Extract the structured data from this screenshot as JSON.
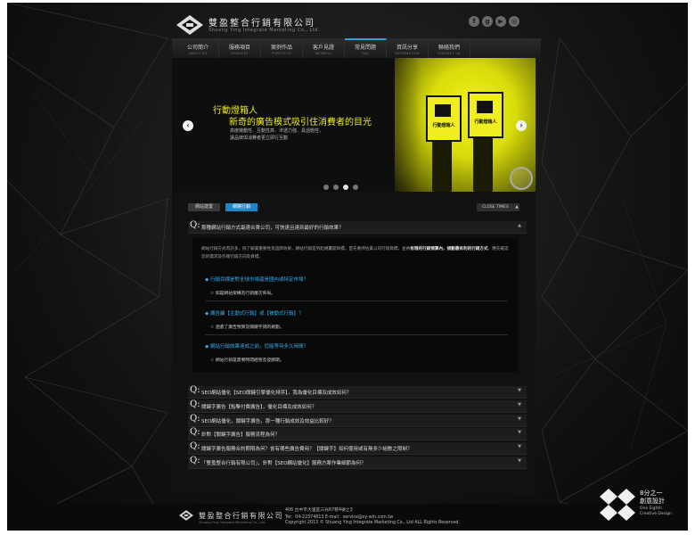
{
  "header": {
    "company_cn": "雙盈整合行銷有限公司",
    "company_en": "Shuang Ying Integrate Marketing Co., Ltd.",
    "social": [
      "f",
      "g",
      "▶",
      "◎"
    ]
  },
  "nav": [
    {
      "cn": "公司簡介",
      "en": "ABOUT US"
    },
    {
      "cn": "服務項目",
      "en": "SERVICES"
    },
    {
      "cn": "案例作品",
      "en": "PORTFOLIO"
    },
    {
      "cn": "客戶見證",
      "en": "WITNESS"
    },
    {
      "cn": "常見問題",
      "en": "FAQ",
      "active": true
    },
    {
      "cn": "資訊分享",
      "en": "INFORMATION"
    },
    {
      "cn": "聯絡我們",
      "en": "CONTACT US"
    }
  ],
  "banner": {
    "title1": "行動燈箱人",
    "title2": "新奇的廣告模式吸引住消費者的目光",
    "lines": [
      "高度機動性．互動性高．滲透力強．具話題性，",
      "讓品牌與消費者更立即行互動"
    ],
    "board_text": "行動燈箱人",
    "left_arrow": "‹",
    "right_arrow": "›",
    "dots": [
      false,
      false,
      true,
      false
    ]
  },
  "tabs": {
    "items": [
      "網站建置",
      "網路行銷"
    ],
    "active_index": 1,
    "close_label": "CLOSE TIMES",
    "close_icon": "▲"
  },
  "faq_open": {
    "q": "Q:",
    "question": "那種網站行銷方式最適合貴公司，可快速且達到最好的行銷效果？",
    "chevron": "▲",
    "intro_part1": "網站行銷方式有許多，除了解貴重要性及品牌效果，網站行銷是另起規畫開目標，首先要評估貴公司行銷目標，並依",
    "intro_bold": "有限的行銷預算內，規劃最有利的行銷方式",
    "intro_part2": "，應先確認您的需求及作哪行銷方向及目標。",
    "sub": [
      {
        "q": "◆ 行銷目標是對全球市場還是國內或特定市場？",
        "a": "☆ 如是網站架構及行銷層次佈局。"
      },
      {
        "q": "◆ 廣告屬【主動式行銷】或【被動式行銷】？",
        "a": "☆ 涵蓋了廣告預算及關鍵字詞的規劃。"
      },
      {
        "q": "◆ 網站行銷效果達成之前，您能等待多久時間？",
        "a": "☆ 網站行銷是需要時間經營及發酵期。"
      }
    ]
  },
  "faq_closed": [
    {
      "q": "Q:",
      "text": "SEO網站優化【SEO關鍵引擎優化排序】，我為優化目標及成效如何？",
      "chevron": "▼"
    },
    {
      "q": "Q:",
      "text": "關鍵字廣告【點擊付費廣告】，優化目標及成效如何？",
      "chevron": "▼"
    },
    {
      "q": "Q:",
      "text": "SEO網站優化，關鍵字廣告，那一種行銷成效及效益比較好？",
      "chevron": "▼"
    },
    {
      "q": "Q:",
      "text": "針對【關鍵字廣告】服務流程為何？",
      "chevron": "▼"
    },
    {
      "q": "Q:",
      "text": "關鍵字廣告服務合約期限為何？會有哪些廣告費用？【關鍵字】如何使用或有無多少組數之限制？",
      "chevron": "▼"
    },
    {
      "q": "Q:",
      "text": "「雙盈整合行銷有限公司」，針對【SEO網站優化】服務方案作業細節為何？",
      "chevron": "▼"
    }
  ],
  "footer": {
    "company_cn": "雙盈整合行銷有限公司",
    "company_en": "Shuang Ying Integrate Marketing Co., Ltd.",
    "address": "406 台中市大里區三光67巷4號之3",
    "contact": "Tel：04-22374813  E-mail：service@sy-win.com.tw",
    "copyright": "Copyright 2013 © Shuang Ying Integrate Marketing Co., Ltd ALL Rights Reserved."
  },
  "studio": {
    "line1": "8分之一",
    "line2": "創意設計",
    "line3": "One Eighth",
    "line4": "Creative Design"
  }
}
